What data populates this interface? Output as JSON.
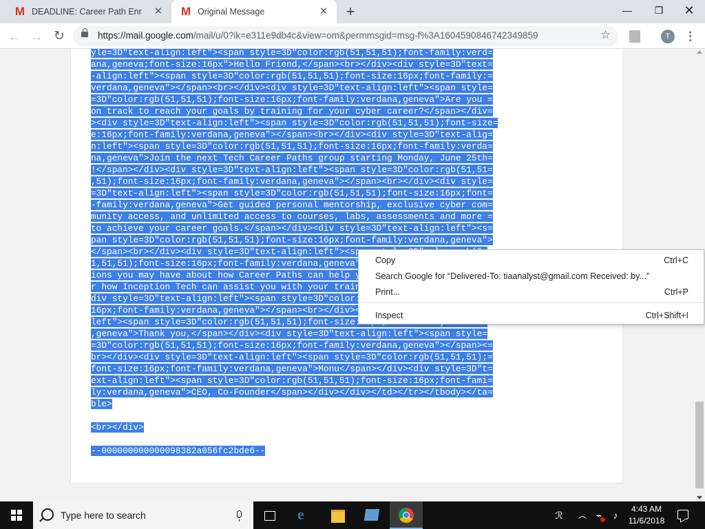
{
  "browser": {
    "tabs": [
      {
        "title": "DEADLINE: Career Path Enrollment",
        "icon": "gmail-icon",
        "active": false
      },
      {
        "title": "Original Message",
        "icon": "gmail-icon",
        "active": true
      }
    ],
    "url_host": "https://mail.google.com",
    "url_rest": "/mail/u/0?ik=e311e9db4c&view=om&permmsgid=msg-f%3A1604590846742349859",
    "profile_initial": "T"
  },
  "message_source": {
    "selected_color": "#3d7fe6",
    "lines": [
      "yle=3D\"text-align:left\"><span style=3D\"color:rgb(51,51,51);font-family:verd=",
      "ana,geneva;font-size:16px\">Hello Friend,</span><br></div><div style=3D\"text=",
      "-align:left\"><span style=3D\"color:rgb(51,51,51);font-size:16px;font-family:=",
      "verdana,geneva\"></span><br></div><div style=3D\"text-align:left\"><span style=",
      "=3D\"color:rgb(51,51,51);font-size:16px;font-family:verdana,geneva\">Are you =",
      "on track to reach your goals by training for your cyber career?</span></div=",
      "><div style=3D\"text-align:left\"><span style=3D\"color:rgb(51,51,51);font-size=",
      "e:16px;font-family:verdana,geneva\"></span><br></div><div style=3D\"text-alig=",
      "n:left\"><span style=3D\"color:rgb(51,51,51);font-size:16px;font-family:verda=",
      "na,geneva\">Join the next Tech Career Paths group starting Monday, June 25th=",
      "!</span></div><div style=3D\"text-align:left\"><span style=3D\"color:rgb(51,51=",
      ",51);font-size:16px;font-family:verdana,geneva\"></span><br></div><div style=",
      "=3D\"text-align:left\"><span style=3D\"color:rgb(51,51,51);font-size:16px;font=",
      "-family:verdana,geneva\">Get guided personal mentorship, exclusive cyber com=",
      "munity access, and unlimited access to courses, labs, assessments and more =",
      "to achieve your career goals.</span></div><div style=3D\"text-align:left\"><s=",
      "pan style=3D\"color:rgb(51,51,51);font-size:16px;font-family:verdana,geneva\">",
      "</span><br></div><div style=3D\"text-align:left\"><span style=3D\"color:rgb(5=",
      "1,51,51);font-size:16px;font-family:verdana,geneva\">If you have any questi=",
      "ions you may have about how Career Paths can help you reach your goals, o=",
      "r how Inception Tech can assist you with your training needs, call us.</span></",
      "div style=3D\"text-align:left\"><span style=3D\"color:rgb(51,51,51);font-size:=",
      "16px;font-family:verdana,geneva\"></span><br></div><div style=3D\"text-align:",
      "left\"><span style=3D\"color:rgb(51,51,51);font-size:16px;font-family:verdana",
      ",geneva\">Thank you,</span></div><div style=3D\"text-align:left\"><span style=",
      "=3D\"color:rgb(51,51,51);font-size:16px;font-family:verdana,geneva\"></span><=",
      "br></div><div style=3D\"text-align:left\"><span style=3D\"color:rgb(51,51,51);=",
      "font-size:16px;font-family:verdana,geneva\">Monu</span></div><div style=3D\"t=",
      "ext-align:left\"><span style=3D\"color:rgb(51,51,51);font-size:16px;font-fami=",
      "ly:verdana,geneva\">CEO, Co-Founder</span></div></div></td></tr></tbody></ta=",
      "ble>"
    ],
    "tail_lines": [
      "<br></div>",
      "--000000000000098382a056fc2bde6--"
    ]
  },
  "context_menu": {
    "items": [
      {
        "label": "Copy",
        "shortcut": "Ctrl+C"
      },
      {
        "label": "Search Google for “Delivered-To: tiaanalyst@gmail.com Received: by...”",
        "shortcut": ""
      },
      {
        "label": "Print...",
        "shortcut": "Ctrl+P"
      },
      {
        "label": "Inspect",
        "shortcut": "Ctrl+Shift+I"
      }
    ]
  },
  "taskbar": {
    "search_placeholder": "Type here to search",
    "time": "4:43 AM",
    "date": "11/6/2018"
  },
  "colors": {
    "selection": "#3d7fe6",
    "gmail_red": "#d93025",
    "taskbar": "#101010"
  }
}
